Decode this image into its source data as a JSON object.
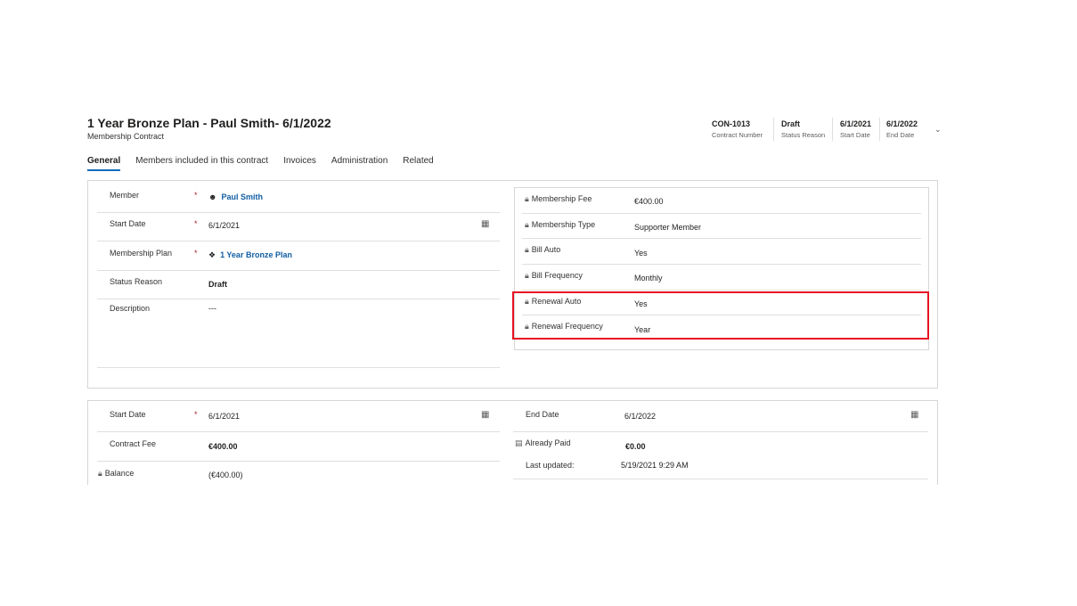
{
  "header": {
    "title": "1 Year Bronze Plan - Paul Smith- 6/1/2022",
    "subtitle": "Membership Contract",
    "fields": [
      {
        "value": "CON-1013",
        "label": "Contract Number"
      },
      {
        "value": "Draft",
        "label": "Status Reason"
      },
      {
        "value": "6/1/2021",
        "label": "Start Date"
      },
      {
        "value": "6/1/2022",
        "label": "End Date"
      }
    ]
  },
  "tabs": [
    "General",
    "Members included in this contract",
    "Invoices",
    "Administration",
    "Related"
  ],
  "section1": {
    "left": {
      "member_label": "Member",
      "member_value": "Paul Smith",
      "start_label": "Start Date",
      "start_value": "6/1/2021",
      "plan_label": "Membership Plan",
      "plan_value": "1 Year Bronze Plan",
      "status_label": "Status Reason",
      "status_value": "Draft",
      "desc_label": "Description",
      "desc_value": "---"
    },
    "right": {
      "fee_label": "Membership Fee",
      "fee_value": "€400.00",
      "type_label": "Membership Type",
      "type_value": "Supporter Member",
      "bill_auto_label": "Bill Auto",
      "bill_auto_value": "Yes",
      "bill_freq_label": "Bill Frequency",
      "bill_freq_value": "Monthly",
      "renewal_auto_label": "Renewal Auto",
      "renewal_auto_value": "Yes",
      "renewal_freq_label": "Renewal Frequency",
      "renewal_freq_value": "Year"
    }
  },
  "section2": {
    "start_label": "Start Date",
    "start_value": "6/1/2021",
    "fee_label": "Contract Fee",
    "fee_value": "€400.00",
    "balance_label": "Balance",
    "balance_value": "(€400.00)",
    "end_label": "End Date",
    "end_value": "6/1/2022",
    "paid_label": "Already Paid",
    "paid_value": "€0.00",
    "updated_label": "Last updated:",
    "updated_value": "5/19/2021 9:29 AM"
  },
  "required_marker": "*",
  "icons": {
    "lock": "lock-icon",
    "calendar": "calendar-icon",
    "contact": "contact-icon",
    "plan": "plan-icon",
    "calculator": "calculator-icon",
    "chevron": "chevron-down-icon"
  },
  "colors": {
    "link": "#115ea3",
    "required": "#a4262c",
    "highlight": "#e81123",
    "tab_accent": "#0f6cbd"
  }
}
